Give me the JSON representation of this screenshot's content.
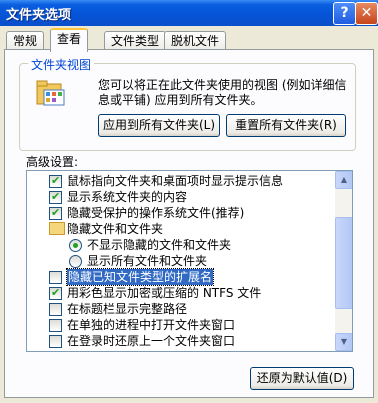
{
  "window": {
    "title": "文件夹选项"
  },
  "titlebar_buttons": {
    "help": "?",
    "close": "✕"
  },
  "tabs": [
    {
      "label": "常规"
    },
    {
      "label": "查看"
    },
    {
      "label": "文件类型"
    },
    {
      "label": "脱机文件"
    }
  ],
  "active_tab": "查看",
  "folder_views": {
    "legend": "文件夹视图",
    "description": "您可以将正在此文件夹使用的视图 (例如详细信息或平铺) 应用到所有文件夹。",
    "apply_all_button": "应用到所有文件夹(L)",
    "reset_all_button": "重置所有文件夹(R)"
  },
  "advanced": {
    "label": "高级设置:",
    "items": [
      {
        "type": "checkbox",
        "checked": true,
        "label": "鼠标指向文件夹和桌面项时显示提示信息"
      },
      {
        "type": "checkbox",
        "checked": true,
        "label": "显示系统文件夹的内容"
      },
      {
        "type": "checkbox",
        "checked": true,
        "label": "隐藏受保护的操作系统文件(推荐)"
      },
      {
        "type": "folder",
        "label": "隐藏文件和文件夹"
      },
      {
        "type": "radio",
        "checked": true,
        "label": "不显示隐藏的文件和文件夹"
      },
      {
        "type": "radio",
        "checked": false,
        "label": "显示所有文件和文件夹"
      },
      {
        "type": "checkbox",
        "checked": false,
        "label": "隐藏已知文件类型的扩展名",
        "selected": true
      },
      {
        "type": "checkbox",
        "checked": true,
        "label": "用彩色显示加密或压缩的 NTFS 文件"
      },
      {
        "type": "checkbox",
        "checked": false,
        "label": "在标题栏显示完整路径"
      },
      {
        "type": "checkbox",
        "checked": false,
        "label": "在单独的进程中打开文件夹窗口"
      },
      {
        "type": "checkbox",
        "checked": false,
        "label": "在登录时还原上一个文件夹窗口"
      }
    ]
  },
  "restore_defaults_button": "还原为默认值(D)",
  "colors": {
    "titlebar": "#0553D6",
    "selection": "#316AC5",
    "dialog_bg": "#ECE9D8",
    "check": "#21A121"
  },
  "icons": {
    "folder_view": "folder-view-icon",
    "folder": "folder-icon",
    "scroll_up": "scroll-up-icon",
    "scroll_down": "scroll-down-icon"
  }
}
